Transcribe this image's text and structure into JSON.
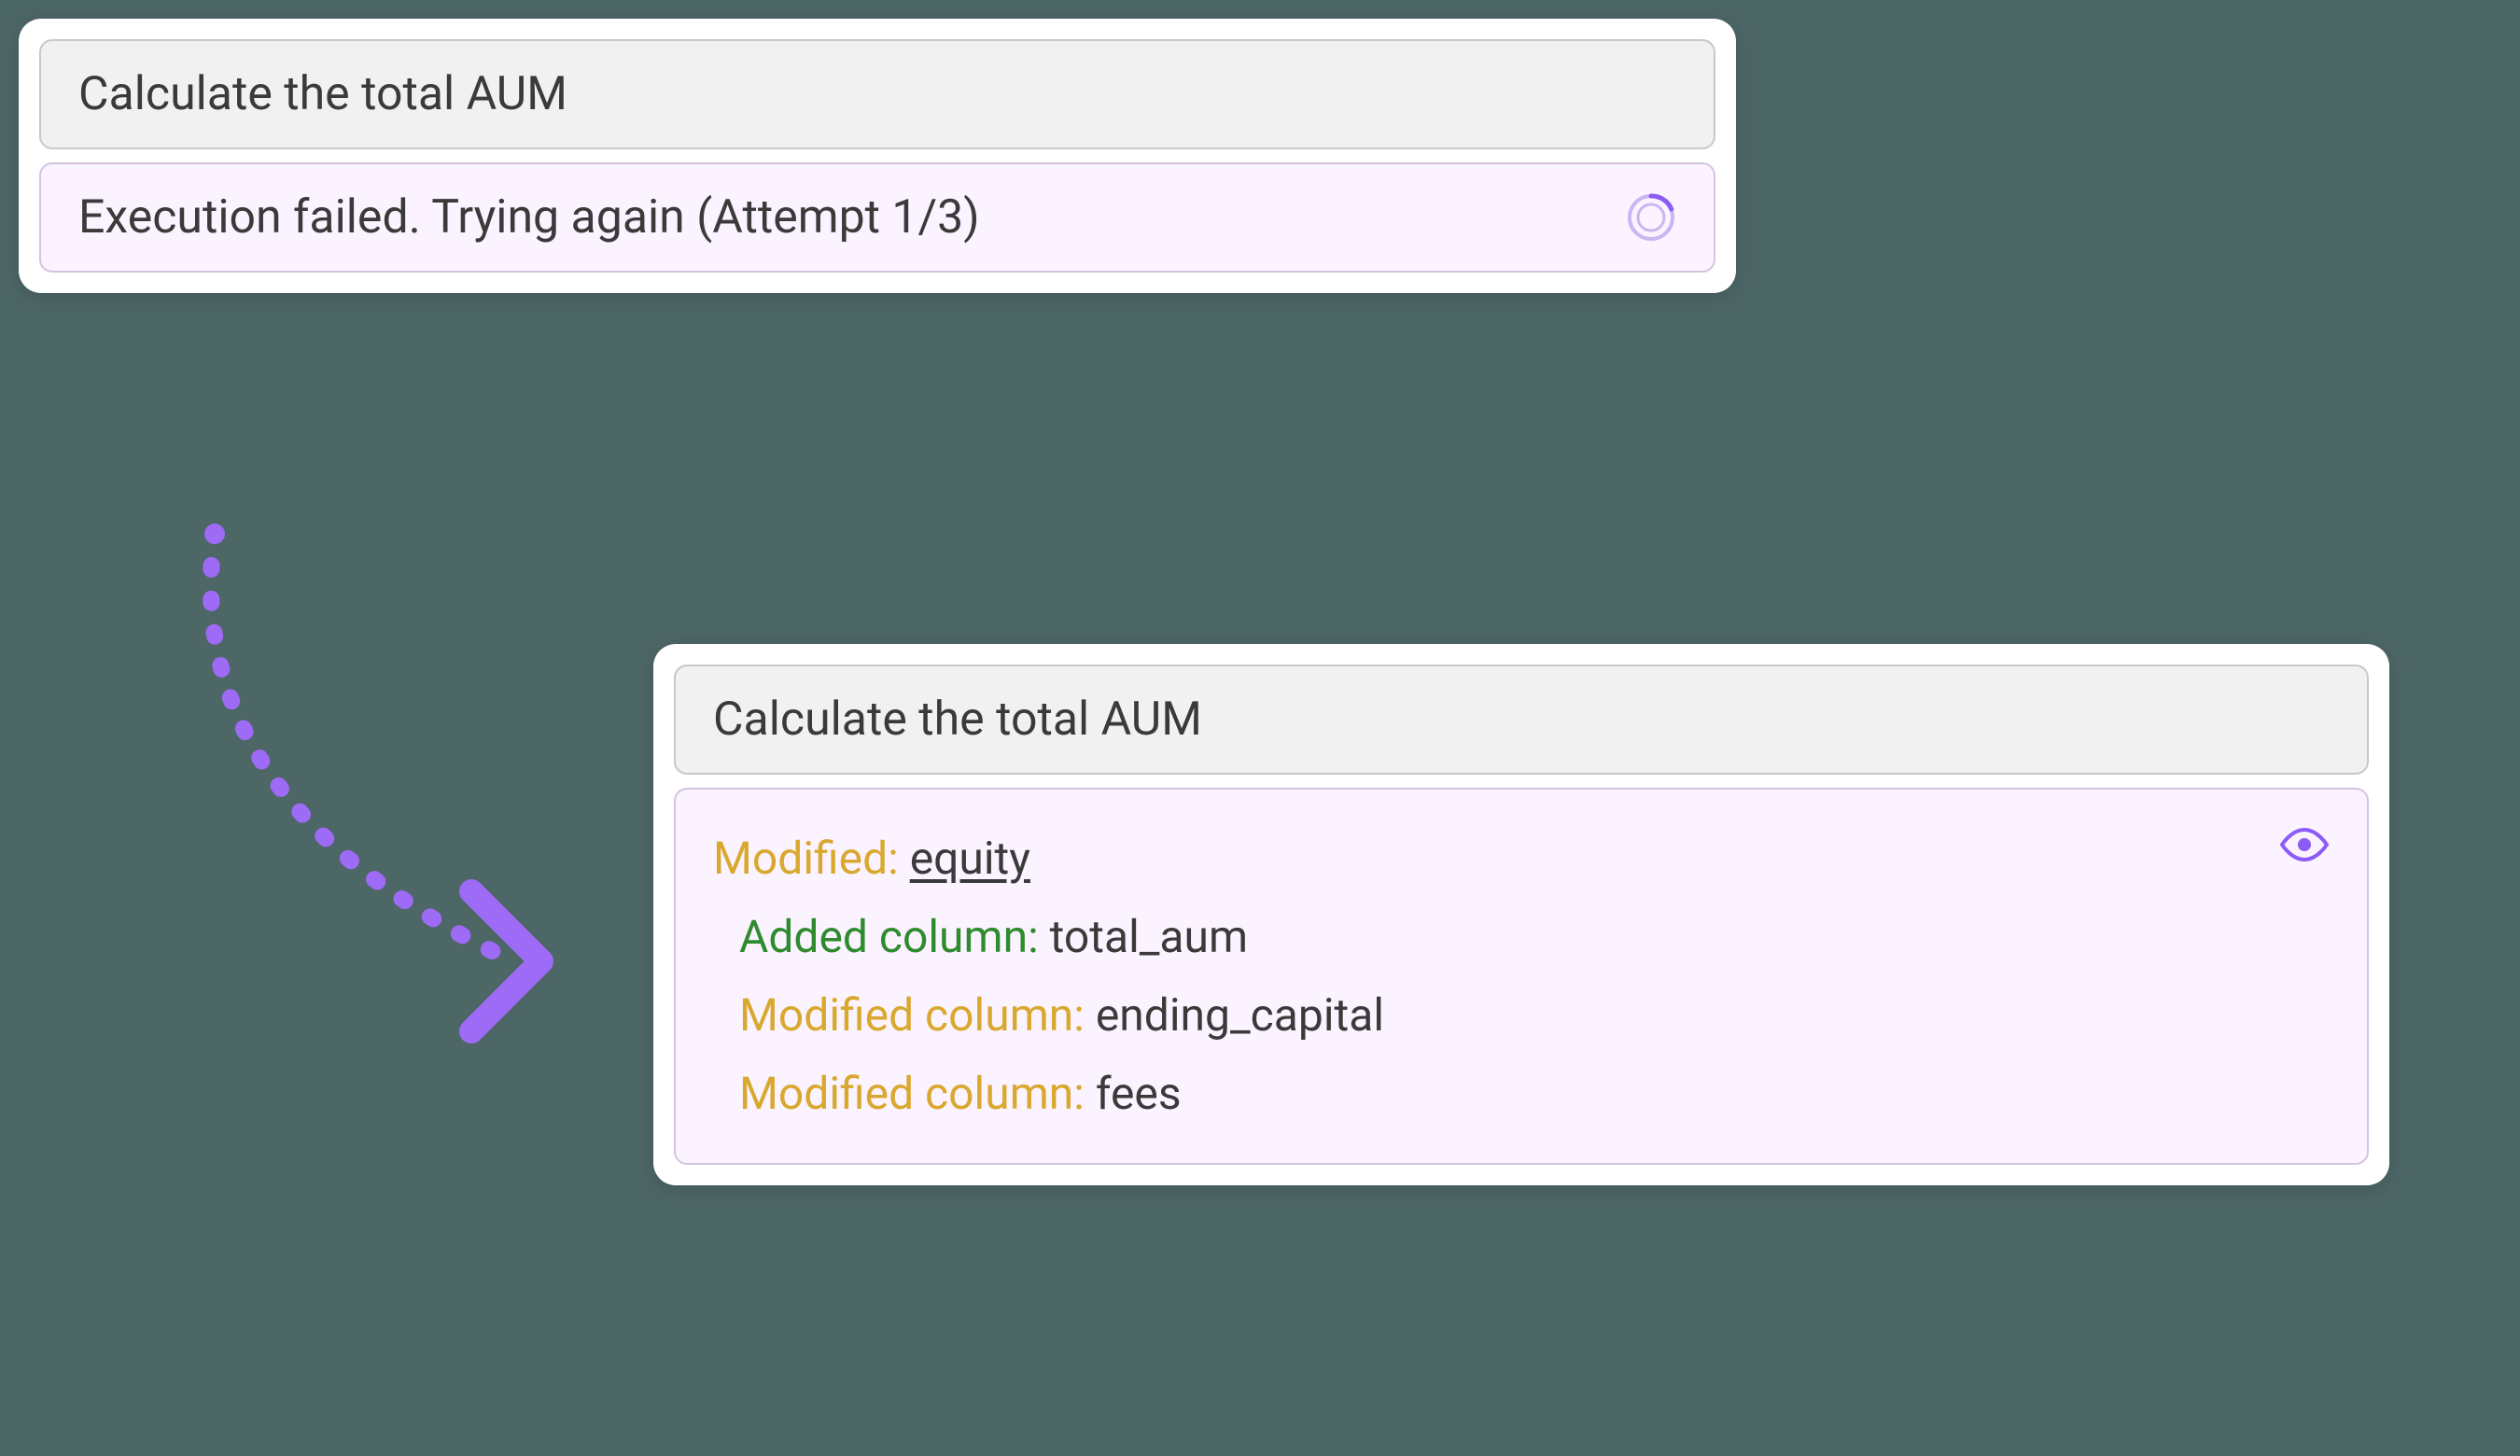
{
  "top_card": {
    "title": "Calculate the total AUM",
    "status": "Execution failed. Trying again (Attempt 1/3)"
  },
  "bottom_card": {
    "title": "Calculate the total AUM",
    "result": {
      "modified_label": "Modified:",
      "modified_value": "equity",
      "changes": [
        {
          "label": "Added column:",
          "value": "total_aum",
          "type": "added"
        },
        {
          "label": "Modified column:",
          "value": "ending_capital",
          "type": "modified"
        },
        {
          "label": "Modified column:",
          "value": "fees",
          "type": "modified"
        }
      ]
    }
  },
  "colors": {
    "accent": "#8b5cf6",
    "added": "#2e8b2e",
    "modified": "#d9a82e"
  }
}
